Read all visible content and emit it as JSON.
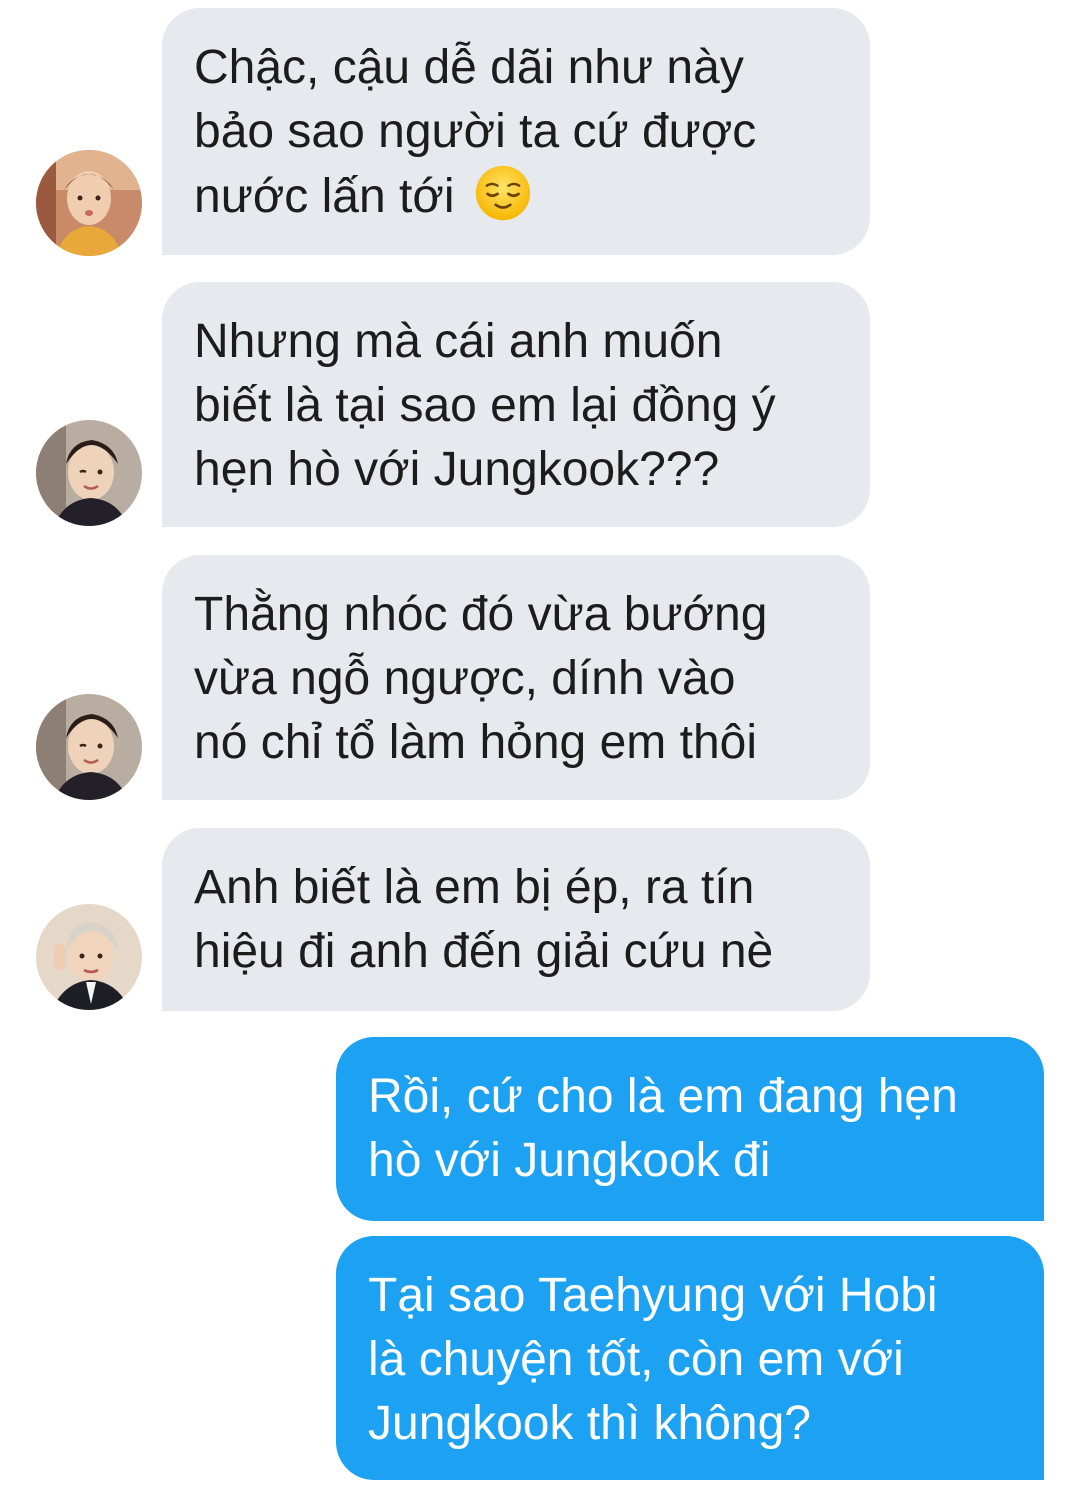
{
  "conversation": {
    "messages": [
      {
        "direction": "incoming",
        "avatar": "avatar-1",
        "text": "Chậc, cậu dễ dãi như này\nbảo sao người ta cứ được\nnước lấn tới",
        "emoji": "relieved-face-emoji"
      },
      {
        "direction": "incoming",
        "avatar": "avatar-2",
        "text": "Nhưng mà cái anh muốn\nbiết là tại sao em lại đồng ý\nhẹn hò với Jungkook???"
      },
      {
        "direction": "incoming",
        "avatar": "avatar-2",
        "text": "Thằng nhóc đó vừa bướng\nvừa ngỗ ngược, dính vào\nnó chỉ tổ làm hỏng em thôi"
      },
      {
        "direction": "incoming",
        "avatar": "avatar-3",
        "text": "Anh biết là em bị ép, ra tín\nhiệu đi anh đến giải cứu nè"
      },
      {
        "direction": "outgoing",
        "text": "Rồi, cứ cho là em đang hẹn\nhò với Jungkook đi"
      },
      {
        "direction": "outgoing",
        "text": "Tại sao Taehyung với Hobi\nlà chuyện tốt, còn em với\nJungkook thì không?"
      }
    ]
  },
  "colors": {
    "incoming_bubble": "#e6e9ed",
    "outgoing_bubble": "#1da1f2",
    "incoming_text": "#1c1c1c",
    "outgoing_text": "#ffffff"
  }
}
